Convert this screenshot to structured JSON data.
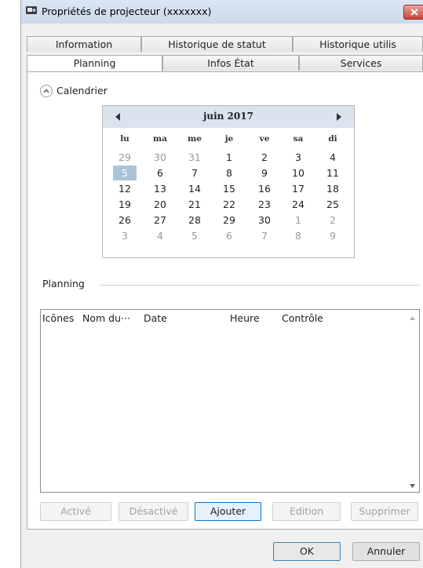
{
  "window": {
    "title": "Propriétés de projecteur (xxxxxxx)"
  },
  "tabs_back": [
    {
      "label": "Information"
    },
    {
      "label": "Historique de statut"
    },
    {
      "label": "Historique utilis"
    }
  ],
  "tabs_front": [
    {
      "label": "Planning",
      "active": true
    },
    {
      "label": "Infos État"
    },
    {
      "label": "Services"
    }
  ],
  "calendar_section": {
    "label": "Calendrier",
    "expanded": true
  },
  "calendar": {
    "month_label": "juin 2017",
    "weekdays": [
      "lu",
      "ma",
      "me",
      "je",
      "ve",
      "sa",
      "di"
    ],
    "weeks": [
      [
        "29",
        "30",
        "31",
        "1",
        "2",
        "3",
        "4"
      ],
      [
        "5",
        "6",
        "7",
        "8",
        "9",
        "10",
        "11"
      ],
      [
        "12",
        "13",
        "14",
        "15",
        "16",
        "17",
        "18"
      ],
      [
        "19",
        "20",
        "21",
        "22",
        "23",
        "24",
        "25"
      ],
      [
        "26",
        "27",
        "28",
        "29",
        "30",
        "1",
        "2"
      ],
      [
        "3",
        "4",
        "5",
        "6",
        "7",
        "8",
        "9"
      ]
    ],
    "selected_day": "5",
    "colors": {
      "header_bg": "#d9e4ef",
      "selected_bg": "#a9c3d8"
    }
  },
  "planning_section": {
    "label": "Planning"
  },
  "planning_list": {
    "columns": [
      "Icônes",
      "Nom du···",
      "Date",
      "Heure",
      "Contrôle"
    ],
    "rows": []
  },
  "action_buttons": {
    "enable": "Activé",
    "disable": "Désactivé",
    "add": "Ajouter",
    "edit": "Edition",
    "delete": "Supprimer"
  },
  "dialog_buttons": {
    "ok": "OK",
    "cancel": "Annuler"
  },
  "accent_color": "#0078d7"
}
